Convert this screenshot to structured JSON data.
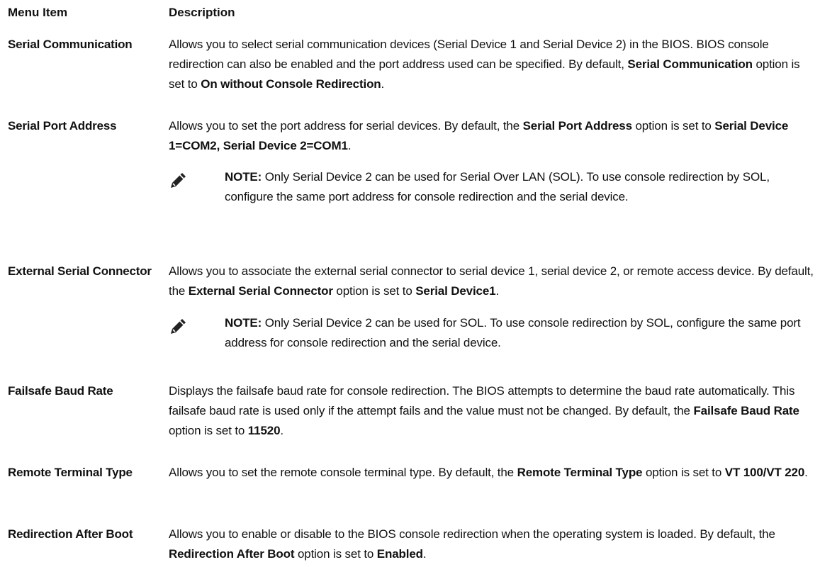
{
  "header": {
    "col_item": "Menu Item",
    "col_desc": "Description"
  },
  "rows": [
    {
      "item": "Serial Communication",
      "desc_parts": [
        "Allows you to select serial communication devices (Serial Device 1 and Serial Device 2) in the BIOS. BIOS console redirection can also be enabled and the port address used can be specified. By default, ",
        "Serial Communication",
        " option is set to ",
        "On without Console Redirection",
        "."
      ]
    },
    {
      "item": "Serial Port Address",
      "desc_parts": [
        "Allows you to set the port address for serial devices. By default, the ",
        "Serial Port Address",
        " option is set to ",
        "Serial Device 1=COM2, Serial Device 2=COM1",
        "."
      ],
      "note": {
        "label": "NOTE:",
        "text": " Only Serial Device 2 can be used for Serial Over LAN (SOL). To use console redirection by SOL, configure the same port address for console redirection and the serial device."
      }
    },
    {
      "item": "External Serial Connector",
      "desc_parts": [
        "Allows you to associate the external serial connector to serial device 1, serial device 2, or remote access device. By default, the ",
        "External Serial Connector",
        " option is set to ",
        "Serial Device1",
        "."
      ],
      "note": {
        "label": "NOTE:",
        "text": " Only Serial Device 2 can be used for SOL. To use console redirection by SOL, configure the same port address for console redirection and the serial device."
      }
    },
    {
      "item": "Failsafe Baud Rate",
      "desc_parts": [
        "Displays the failsafe baud rate for console redirection. The BIOS attempts to determine the baud rate automatically. This failsafe baud rate is used only if the attempt fails and the value must not be changed. By default, the ",
        "Failsafe Baud Rate",
        " option is set to ",
        "11520",
        "."
      ]
    },
    {
      "item": "Remote Terminal Type",
      "desc_parts": [
        "Allows you to set the remote console terminal type. By default, the ",
        "Remote Terminal Type",
        " option is set to ",
        "VT 100/VT 220",
        "."
      ]
    },
    {
      "item": "Redirection After Boot",
      "desc_parts": [
        "Allows you to enable or disable to the BIOS console redirection when the operating system is loaded. By default, the ",
        "Redirection After Boot",
        " option is set to ",
        "Enabled",
        "."
      ]
    }
  ],
  "icons": {
    "note": "note-pencil-icon"
  },
  "colors": {
    "text": "#111111",
    "icon": "#222222"
  }
}
